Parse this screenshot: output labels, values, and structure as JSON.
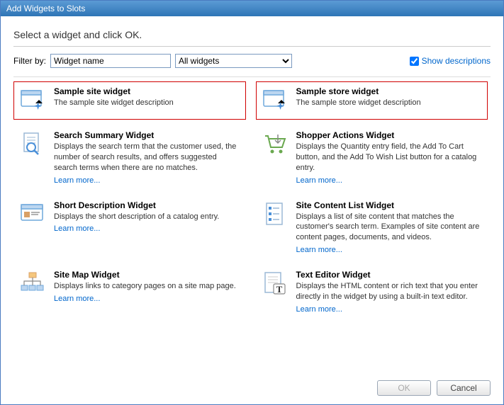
{
  "titlebar": "Add Widgets to Slots",
  "instruction": "Select a widget and click OK.",
  "filter": {
    "label": "Filter by:",
    "input_value": "Widget name",
    "select_value": "All widgets"
  },
  "show_descriptions": {
    "label": "Show descriptions",
    "checked": true
  },
  "learn_more_label": "Learn more...",
  "widgets": [
    {
      "title": "Sample site widget",
      "desc": "The sample site widget description",
      "highlighted": true,
      "icon": "window-new",
      "learn_more": false
    },
    {
      "title": "Sample store widget",
      "desc": "The sample store widget description",
      "highlighted": true,
      "icon": "window-new",
      "learn_more": false
    },
    {
      "title": "Search Summary Widget",
      "desc": "Displays the search term that the customer used, the number of search results, and offers suggested search terms when there are no matches.",
      "highlighted": false,
      "icon": "search-doc",
      "learn_more": true
    },
    {
      "title": "Shopper Actions Widget",
      "desc": "Displays the Quantity entry field, the Add To Cart button, and the Add To Wish List button for a catalog entry.",
      "highlighted": false,
      "icon": "shopping-cart",
      "learn_more": true
    },
    {
      "title": "Short Description Widget",
      "desc": "Displays the short description of a catalog entry.",
      "highlighted": false,
      "icon": "short-desc",
      "learn_more": true
    },
    {
      "title": "Site Content List Widget",
      "desc": "Displays a list of site content that matches the customer's search term. Examples of site content are content pages, documents, and videos.",
      "highlighted": false,
      "icon": "content-list",
      "learn_more": true
    },
    {
      "title": "Site Map Widget",
      "desc": "Displays links to category pages on a site map page.",
      "highlighted": false,
      "icon": "site-map",
      "learn_more": true
    },
    {
      "title": "Text Editor Widget",
      "desc": "Displays the HTML content or rich text that you enter directly in the widget by using a built-in text editor.",
      "highlighted": false,
      "icon": "text-editor",
      "learn_more": true
    }
  ],
  "buttons": {
    "ok": "OK",
    "cancel": "Cancel"
  }
}
